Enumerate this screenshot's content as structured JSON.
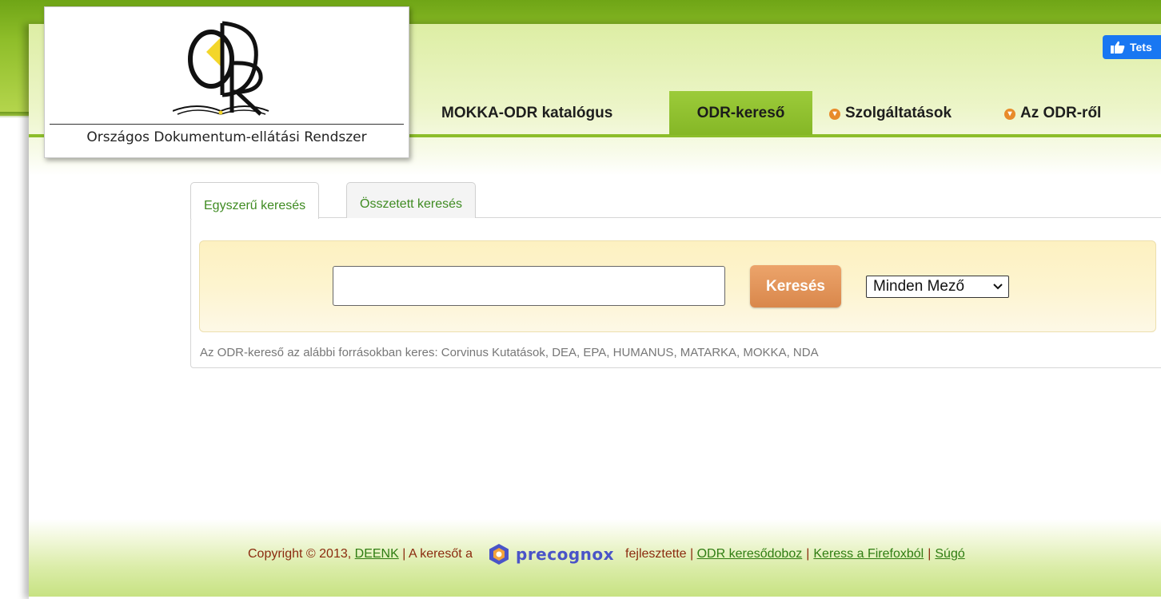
{
  "colors": {
    "brand_green": "#8cbd2a",
    "search_button": "#e09555",
    "footer_text": "#8b2b0e",
    "link_green": "#2f7d12",
    "facebook": "#1877f2"
  },
  "logo": {
    "caption": "Országos Dokumentum-ellátási Rendszer"
  },
  "facebook": {
    "label": "Tets",
    "icon": "thumbs-up-icon"
  },
  "nav": {
    "items": [
      {
        "label": "MOKKA-ODR katalógus",
        "active": false,
        "bullet": false
      },
      {
        "label": "ODR-kereső",
        "active": true,
        "bullet": false
      },
      {
        "label": "Szolgáltatások",
        "active": false,
        "bullet": true
      },
      {
        "label": "Az ODR-ről",
        "active": false,
        "bullet": true
      }
    ]
  },
  "search": {
    "tabs": [
      {
        "label": "Egyszerű keresés",
        "active": true
      },
      {
        "label": "Összetett keresés",
        "active": false
      }
    ],
    "input_value": "",
    "button_label": "Keresés",
    "field_selected": "Minden Mező",
    "sources_note": "Az ODR-kereső az alábbi forrásokban keres: Corvinus Kutatások, DEA, EPA, HUMANUS, MATARKA, MOKKA, NDA"
  },
  "footer": {
    "copyright": "Copyright © 2013,",
    "deenk": "DEENK",
    "made_by": "| A keresőt a",
    "precognox": "precognox",
    "developed": "fejlesztette |",
    "link_searchbox": "ODR keresődoboz",
    "link_firefox": "Keress a Firefoxból",
    "link_help": "Súgó"
  }
}
